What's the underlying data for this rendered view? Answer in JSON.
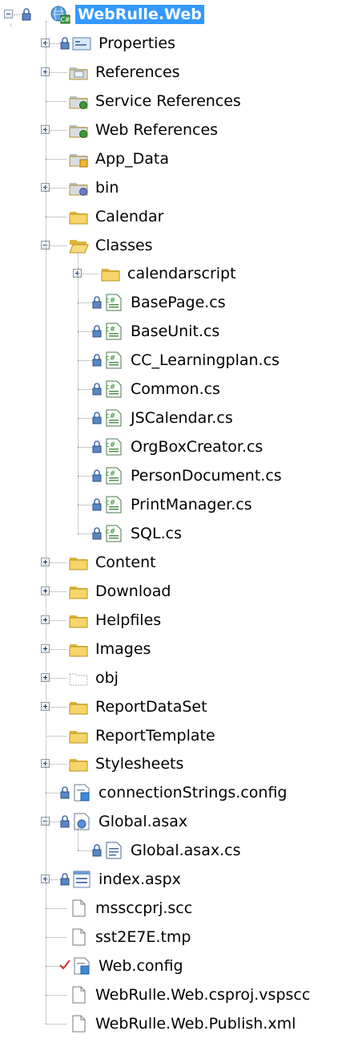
{
  "project": {
    "name": "WebRulle.Web"
  },
  "items": [
    {
      "label": "Properties",
      "icon": "properties-icon"
    },
    {
      "label": "References",
      "icon": "references-icon"
    },
    {
      "label": "Service References",
      "icon": "service-references-icon"
    },
    {
      "label": "Web References",
      "icon": "web-references-icon"
    },
    {
      "label": "App_Data",
      "icon": "app-data-folder-icon"
    },
    {
      "label": "bin",
      "icon": "bin-folder-icon"
    },
    {
      "label": "Calendar",
      "icon": "folder-icon"
    },
    {
      "label": "Classes",
      "icon": "folder-open-icon"
    },
    {
      "label": "calendarscript",
      "icon": "folder-icon"
    },
    {
      "label": "BasePage.cs",
      "icon": "csharp-file-icon"
    },
    {
      "label": "BaseUnit.cs",
      "icon": "csharp-file-icon"
    },
    {
      "label": "CC_Learningplan.cs",
      "icon": "csharp-file-icon"
    },
    {
      "label": "Common.cs",
      "icon": "csharp-file-icon"
    },
    {
      "label": "JSCalendar.cs",
      "icon": "csharp-file-icon"
    },
    {
      "label": "OrgBoxCreator.cs",
      "icon": "csharp-file-icon"
    },
    {
      "label": "PersonDocument.cs",
      "icon": "csharp-file-icon"
    },
    {
      "label": "PrintManager.cs",
      "icon": "csharp-file-icon"
    },
    {
      "label": "SQL.cs",
      "icon": "csharp-file-icon"
    },
    {
      "label": "Content",
      "icon": "folder-icon"
    },
    {
      "label": "Download",
      "icon": "folder-icon"
    },
    {
      "label": "Helpfiles",
      "icon": "folder-icon"
    },
    {
      "label": "Images",
      "icon": "folder-icon"
    },
    {
      "label": "obj",
      "icon": "excluded-folder-icon"
    },
    {
      "label": "ReportDataSet",
      "icon": "folder-icon"
    },
    {
      "label": "ReportTemplate",
      "icon": "folder-icon"
    },
    {
      "label": "Stylesheets",
      "icon": "folder-icon"
    },
    {
      "label": "connectionStrings.config",
      "icon": "config-file-icon"
    },
    {
      "label": "Global.asax",
      "icon": "asax-file-icon"
    },
    {
      "label": "Global.asax.cs",
      "icon": "csharp-code-file-icon"
    },
    {
      "label": "index.aspx",
      "icon": "aspx-file-icon"
    },
    {
      "label": "mssccprj.scc",
      "icon": "blank-file-icon"
    },
    {
      "label": "sst2E7E.tmp",
      "icon": "blank-file-icon"
    },
    {
      "label": "Web.config",
      "icon": "config-file-icon"
    },
    {
      "label": "WebRulle.Web.csproj.vspscc",
      "icon": "blank-file-icon"
    },
    {
      "label": "WebRulle.Web.Publish.xml",
      "icon": "blank-file-icon"
    }
  ]
}
